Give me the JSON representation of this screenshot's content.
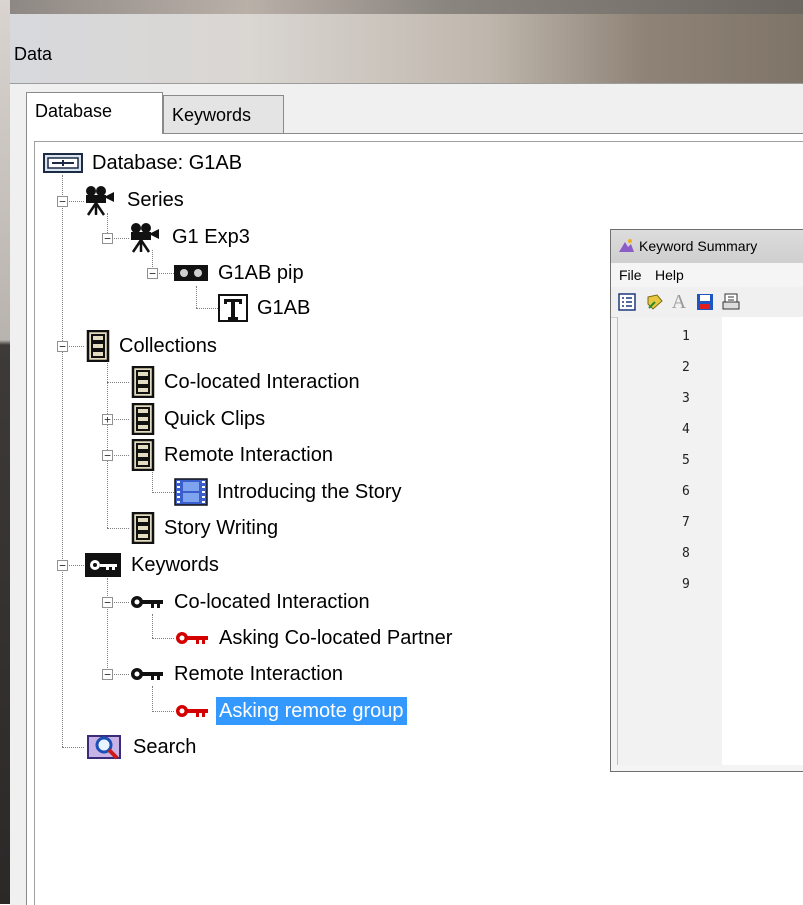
{
  "window": {
    "title": "Data"
  },
  "tabs": [
    {
      "label": "Database"
    },
    {
      "label": "Keywords"
    }
  ],
  "tree": {
    "root": "Database: G1AB",
    "series": "Series",
    "series_child": "G1 Exp3",
    "episode": "G1AB pip",
    "transcript": "G1AB",
    "collections": "Collections",
    "collection_items": [
      "Co-located Interaction",
      "Quick Clips",
      "Remote Interaction",
      "Introducing the Story",
      "Story Writing"
    ],
    "keywords": "Keywords",
    "kw_group1": "Co-located Interaction",
    "kw_group1_item": "Asking Co-located Partner",
    "kw_group2": "Remote Interaction",
    "kw_group2_item": "Asking remote group",
    "search": "Search"
  },
  "keyword_summary": {
    "title": "Keyword Summary",
    "menu": [
      "File",
      "Help"
    ],
    "line_numbers": [
      "1",
      "2",
      "3",
      "4",
      "5",
      "6",
      "7",
      "8",
      "9"
    ],
    "toolbar_icons": [
      "list-icon",
      "keyword-icon",
      "font-icon",
      "save-icon",
      "print-icon"
    ]
  },
  "colors": {
    "selection": "#3399ff",
    "keyword_red": "#d40000"
  }
}
